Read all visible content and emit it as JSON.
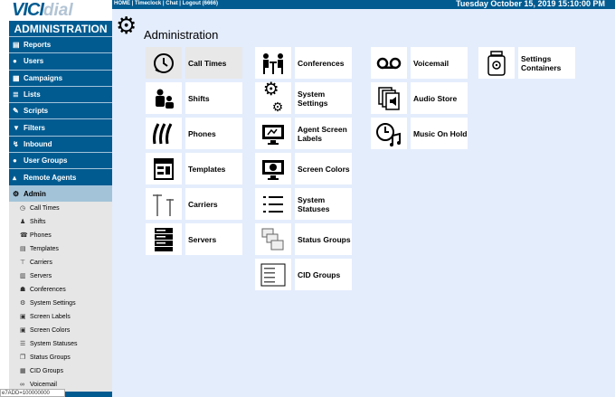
{
  "brand": {
    "logo_vici": "VICI",
    "logo_dial": "dial",
    "section_title": "ADMINISTRATION"
  },
  "header": {
    "links": [
      "HOME",
      "Timeclock",
      "Chat",
      "Logout (6666)"
    ],
    "separator": " | ",
    "date": "Tuesday October 15, 2019 15:10:00 PM"
  },
  "sidebar": {
    "items": [
      {
        "label": "Reports",
        "icon": "bar-chart-icon"
      },
      {
        "label": "Users",
        "icon": "users-icon"
      },
      {
        "label": "Campaigns",
        "icon": "campaigns-icon"
      },
      {
        "label": "Lists",
        "icon": "list-icon"
      },
      {
        "label": "Scripts",
        "icon": "script-icon"
      },
      {
        "label": "Filters",
        "icon": "filter-icon"
      },
      {
        "label": "Inbound",
        "icon": "inbound-icon"
      },
      {
        "label": "User Groups",
        "icon": "user-groups-icon"
      },
      {
        "label": "Remote Agents",
        "icon": "remote-agents-icon"
      },
      {
        "label": "Admin",
        "icon": "gear-icon"
      }
    ],
    "submenu": [
      {
        "label": "Call Times",
        "icon": "clock-icon"
      },
      {
        "label": "Shifts",
        "icon": "shifts-icon"
      },
      {
        "label": "Phones",
        "icon": "phones-icon"
      },
      {
        "label": "Templates",
        "icon": "templates-icon"
      },
      {
        "label": "Carriers",
        "icon": "carriers-icon"
      },
      {
        "label": "Servers",
        "icon": "servers-icon"
      },
      {
        "label": "Conferences",
        "icon": "conferences-icon"
      },
      {
        "label": "System Settings",
        "icon": "gears-icon"
      },
      {
        "label": "Screen Labels",
        "icon": "screen-labels-icon"
      },
      {
        "label": "Screen Colors",
        "icon": "screen-colors-icon"
      },
      {
        "label": "System Statuses",
        "icon": "list-icon"
      },
      {
        "label": "Status Groups",
        "icon": "status-groups-icon"
      },
      {
        "label": "CID Groups",
        "icon": "cid-groups-icon"
      },
      {
        "label": "Voicemail",
        "icon": "voicemail-icon"
      }
    ]
  },
  "main": {
    "title": "Administration",
    "tiles": [
      {
        "label": "Call Times",
        "icon": "clock-icon",
        "selected": true
      },
      {
        "label": "Shifts",
        "icon": "shifts-icon"
      },
      {
        "label": "Phones",
        "icon": "phones-icon"
      },
      {
        "label": "Templates",
        "icon": "templates-icon"
      },
      {
        "label": "Carriers",
        "icon": "carriers-icon"
      },
      {
        "label": "Servers",
        "icon": "servers-icon"
      },
      {
        "label": "Conferences",
        "icon": "conferences-icon"
      },
      {
        "label": "System Settings",
        "icon": "gears-icon"
      },
      {
        "label": "Agent Screen Labels",
        "icon": "screen-labels-icon"
      },
      {
        "label": "Screen Colors",
        "icon": "screen-colors-icon"
      },
      {
        "label": "System Statuses",
        "icon": "list-icon"
      },
      {
        "label": "Status Groups",
        "icon": "status-groups-icon"
      },
      {
        "label": "CID Groups",
        "icon": "cid-groups-icon"
      },
      {
        "label": "Voicemail",
        "icon": "voicemail-icon"
      },
      {
        "label": "Audio Store",
        "icon": "audio-store-icon"
      },
      {
        "label": "Music On Hold",
        "icon": "music-on-hold-icon"
      },
      {
        "label": "Settings Containers",
        "icon": "settings-containers-icon"
      }
    ]
  },
  "statusbar": {
    "text": "e7ADD=100000000"
  },
  "colors": {
    "primary": "#015b91",
    "background": "#e4edfc",
    "tile": "#ffffff",
    "sidebar_active": "#a3c3d9",
    "submenu": "#e6e6e6"
  }
}
